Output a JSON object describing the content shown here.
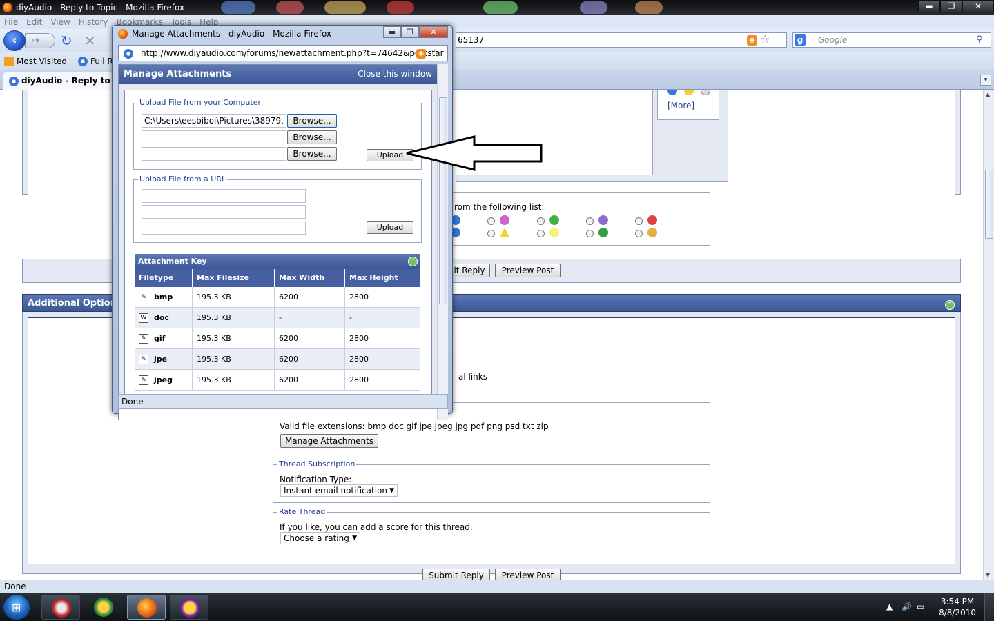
{
  "window": {
    "title": "diyAudio - Reply to Topic - Mozilla Firefox",
    "min": "▬",
    "max": "❐",
    "close": "✕"
  },
  "menu": [
    "File",
    "Edit",
    "View",
    "History",
    "Bookmarks",
    "Tools",
    "Help"
  ],
  "nav": {
    "url_partial": "65137",
    "search_placeholder": "Google"
  },
  "bookmarks": [
    "Most Visited",
    "Full Ran"
  ],
  "tab": {
    "label": "diyAudio - Reply to Top"
  },
  "page": {
    "more_link": "[More]",
    "smilies_text": "rom the following list:",
    "submit_reply_1": "it Reply",
    "preview_post_1": "Preview Post",
    "additional_options": "Additional Option",
    "links_text": "al links",
    "valid_extensions": "Valid file extensions: bmp doc gif jpe jpeg jpg pdf png psd txt zip",
    "manage_attachments": "Manage Attachments",
    "thread_subscription": "Thread Subscription",
    "notification_type": "Notification Type:",
    "notification_value": "Instant email notification",
    "rate_thread": "Rate Thread",
    "rate_text": "If you like, you can add a score for this thread.",
    "rating_value": "Choose a rating",
    "submit_reply_2": "Submit Reply",
    "preview_post_2": "Preview Post"
  },
  "status": "Done",
  "popup": {
    "title": "Manage Attachments - diyAudio - Mozilla Firefox",
    "url": "http://www.diyaudio.com/forums/newattachment.php?t=74642&poststar",
    "header": "Manage Attachments",
    "close_window": "Close this window",
    "upload_computer_legend": "Upload File from your Computer",
    "file1_value": "C:\\Users\\eesbiboi\\Pictures\\38979.",
    "browse": "Browse...",
    "upload": "Upload",
    "upload_url_legend": "Upload File from a URL",
    "attachment_key": "Attachment Key",
    "columns": [
      "Filetype",
      "Max Filesize",
      "Max Width",
      "Max Height"
    ],
    "rows": [
      {
        "type": "bmp",
        "size": "195.3 KB",
        "width": "6200",
        "height": "2800"
      },
      {
        "type": "doc",
        "size": "195.3 KB",
        "width": "-",
        "height": "-"
      },
      {
        "type": "gif",
        "size": "195.3 KB",
        "width": "6200",
        "height": "2800"
      },
      {
        "type": "jpe",
        "size": "195.3 KB",
        "width": "6200",
        "height": "2800"
      },
      {
        "type": "jpeg",
        "size": "195.3 KB",
        "width": "6200",
        "height": "2800"
      }
    ],
    "status": "Done"
  },
  "taskbar": {
    "time": "3:54 PM",
    "date": "8/8/2010"
  }
}
